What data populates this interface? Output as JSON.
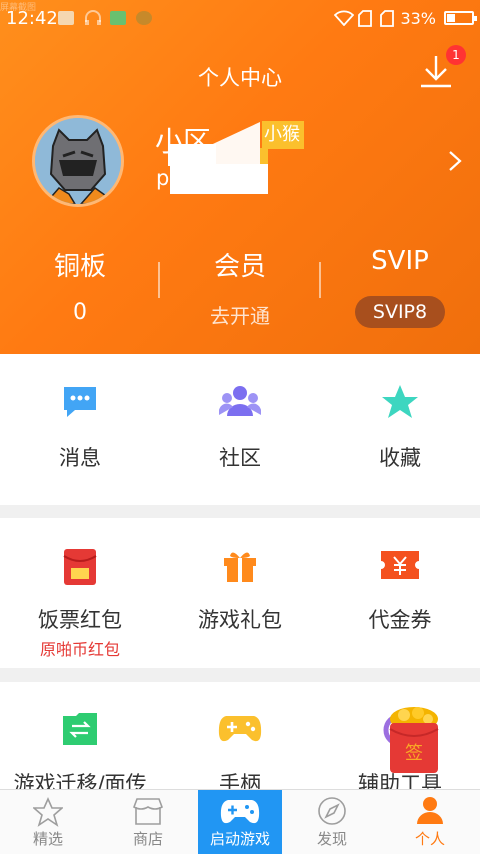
{
  "status_bar": {
    "time": "12:42",
    "overlay_text": "屏幕截图",
    "battery_percent": "33%",
    "battery_level": 0.33
  },
  "header": {
    "title": "个人中心",
    "download_badge": "1"
  },
  "profile": {
    "name": "小区",
    "vip_tag": "小猴",
    "uid": "p                  90"
  },
  "stats": [
    {
      "label": "铜板",
      "value": "0"
    },
    {
      "label": "会员",
      "value": "去开通"
    },
    {
      "label": "SVIP",
      "value": "SVIP8"
    }
  ],
  "section1": [
    {
      "label": "消息",
      "icon": "message-icon"
    },
    {
      "label": "社区",
      "icon": "community-icon"
    },
    {
      "label": "收藏",
      "icon": "favorite-star-icon"
    }
  ],
  "section2": [
    {
      "label": "饭票红包",
      "sub": "原啪币红包",
      "icon": "red-packet-icon"
    },
    {
      "label": "游戏礼包",
      "icon": "gift-icon"
    },
    {
      "label": "代金券",
      "icon": "voucher-icon"
    }
  ],
  "section3": [
    {
      "label": "游戏迁移/面传",
      "icon": "transfer-icon"
    },
    {
      "label": "手柄",
      "icon": "gamepad-icon"
    },
    {
      "label": "辅助工具",
      "icon": "tools-icon"
    }
  ],
  "floating": {
    "sign_label": "签"
  },
  "tabs": [
    {
      "label": "精选",
      "icon": "star-outline-icon"
    },
    {
      "label": "商店",
      "icon": "store-icon"
    },
    {
      "label": "启动游戏",
      "icon": "gamepad-icon"
    },
    {
      "label": "发现",
      "icon": "compass-icon"
    },
    {
      "label": "个人",
      "icon": "person-icon"
    }
  ],
  "colors": {
    "header_orange": "#ff8412",
    "accent_orange": "#ff7a12",
    "launch_blue": "#2196f3",
    "red_text": "#e53935"
  }
}
